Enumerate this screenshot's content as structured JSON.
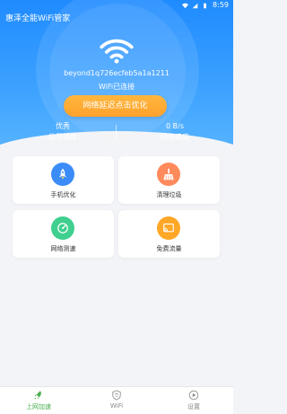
{
  "status": {
    "time": "8:59"
  },
  "app": {
    "title": "惠泽全能WiFi管家"
  },
  "wifi": {
    "ssid": "beyond1q726ecfeb5a1a1211",
    "state": "WiFi已连接"
  },
  "actions": {
    "optimize_label": "网络延迟点击优化"
  },
  "stats": {
    "signal": {
      "value": "优秀",
      "label": "信号强度"
    },
    "speed": {
      "value": "0 B/s",
      "label": "网络速度"
    }
  },
  "grid": [
    {
      "label": "手机优化",
      "icon": "rocket-icon",
      "color": "#3b8cf8"
    },
    {
      "label": "清理垃圾",
      "icon": "broom-icon",
      "color": "#ff8a5c"
    },
    {
      "label": "网络测速",
      "icon": "speedometer-icon",
      "color": "#3fcf8e"
    },
    {
      "label": "免费流量",
      "icon": "cast-icon",
      "color": "#ffa726"
    }
  ],
  "tabs": [
    {
      "label": "上网加速",
      "icon": "rocket-icon",
      "active": true,
      "color": "#4caf50"
    },
    {
      "label": "WiFi",
      "icon": "wifi-shield-icon",
      "active": false,
      "color": "#8a8a8a"
    },
    {
      "label": "设置",
      "icon": "play-circle-icon",
      "active": false,
      "color": "#8a8a8a"
    }
  ]
}
